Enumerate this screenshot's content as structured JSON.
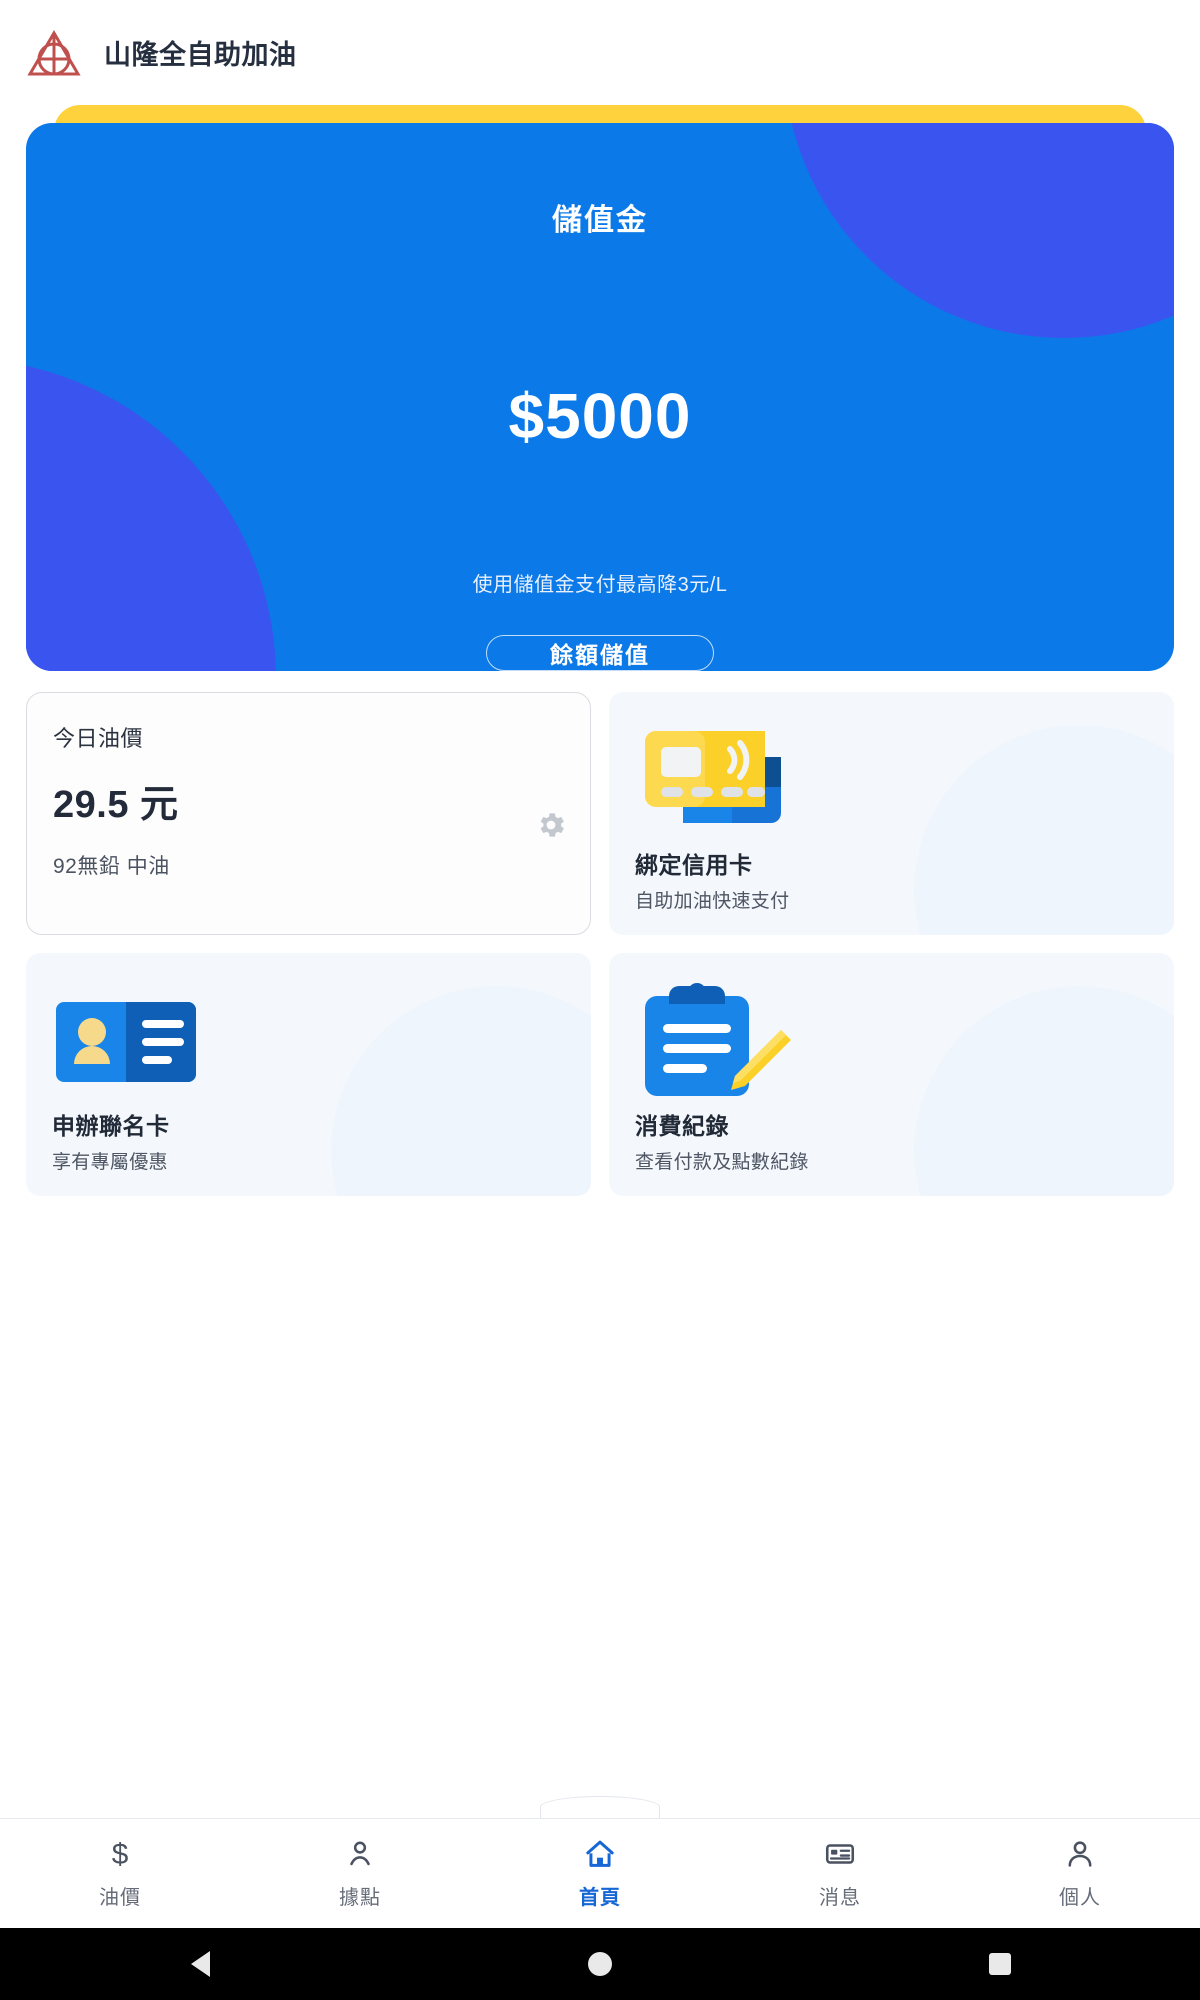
{
  "header": {
    "app_title": "山隆全自助加油",
    "logo_icon": "triangle-circle-cross-logo",
    "logo_color": "#c0504d"
  },
  "balance_card": {
    "label": "儲值金",
    "amount": "$5000",
    "note": "使用儲值金支付最高降3元/L",
    "topup_label": "餘額儲值",
    "card_color": "#0b79e8",
    "blob_color": "#3a55ef",
    "behind_card_color": "#fdd23c"
  },
  "tiles": {
    "fuel_price": {
      "title": "今日油價",
      "price": "29.5 元",
      "fuel_type": "92無鉛 中油",
      "settings_icon": "gear-icon"
    },
    "bind_card": {
      "title": "綁定信用卡",
      "desc": "自助加油快速支付",
      "icon": "credit-card-contactless-icon"
    },
    "apply_card": {
      "title": "申辦聯名卡",
      "desc": "享有專屬優惠",
      "icon": "id-card-icon"
    },
    "records": {
      "title": "消費紀錄",
      "desc": "查看付款及點數紀錄",
      "icon": "clipboard-pencil-icon"
    }
  },
  "bottom_nav": {
    "active_color": "#1766d6",
    "items": [
      {
        "label": "油價",
        "icon": "dollar-icon",
        "active": false
      },
      {
        "label": "據點",
        "icon": "location-pin-icon",
        "active": false
      },
      {
        "label": "首頁",
        "icon": "home-icon",
        "active": true
      },
      {
        "label": "消息",
        "icon": "message-card-icon",
        "active": false
      },
      {
        "label": "個人",
        "icon": "person-icon",
        "active": false
      }
    ]
  },
  "system_nav": {
    "back": "back-triangle-icon",
    "home": "home-circle-icon",
    "recents": "recents-square-icon"
  }
}
